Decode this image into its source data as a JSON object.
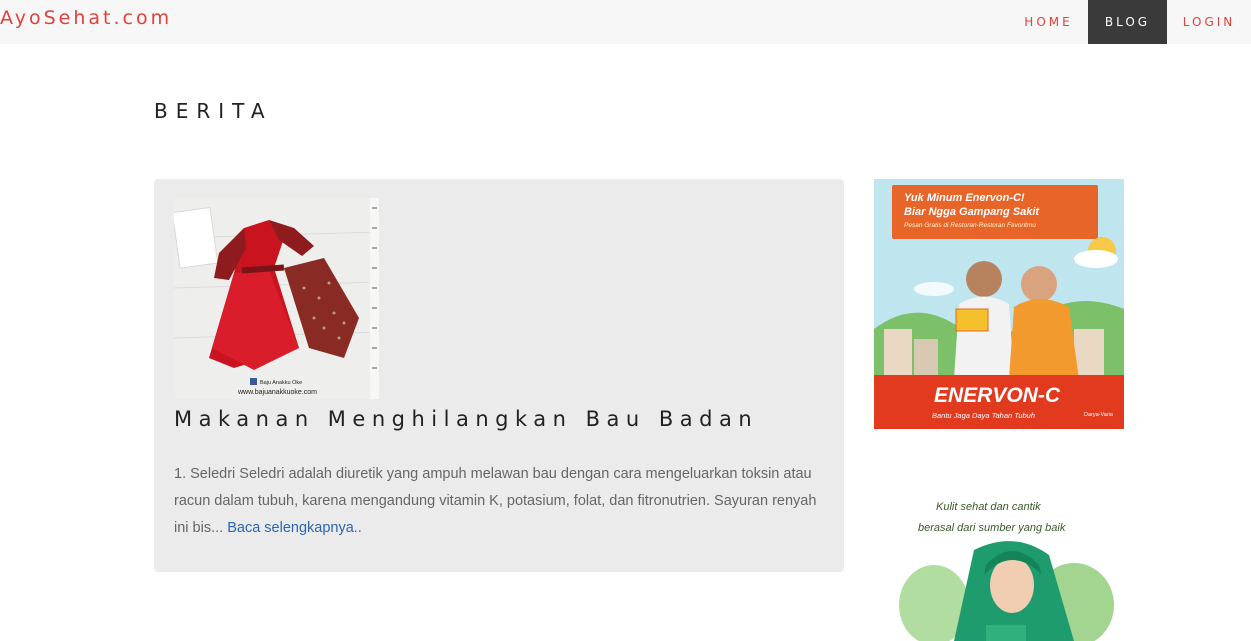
{
  "brand": {
    "name": "AyoSehat.com"
  },
  "nav": {
    "home": "HOME",
    "blog": "BLOG",
    "login": "LOGIN"
  },
  "page": {
    "title": "BERITA"
  },
  "post": {
    "title": "Makanan Menghilangkan Bau Badan",
    "excerpt": "1. Seledri Seledri adalah diuretik yang ampuh melawan bau dengan cara mengeluarkan toksin atau racun dalam tubuh, karena mengandung vitamin K, potasium, folat, dan fitronutrien. Sayuran renyah ini bis...",
    "read_more": "Baca selengkapnya..",
    "thumb_caption_1": "Baju Anakku Oke",
    "thumb_caption_2": "www.bajuanakkuoke.com"
  },
  "ads": {
    "ad1": {
      "line1": "Yuk Minum Enervon-C!",
      "line2": "Biar Ngga Gampang Sakit",
      "line3": "Pesan Gratis di Restoran-Restoran Favoritmu",
      "brand": "ENERVON-C",
      "tagline": "Bantu Jaga Daya Tahan Tubuh",
      "maker": "Darya-Varia"
    },
    "ad2": {
      "line1": "Kulit sehat dan cantik",
      "line2": "berasal dari sumber yang baik"
    }
  },
  "colors": {
    "brand": "#e0413b",
    "nav_active_bg": "#3a3a3a",
    "link": "#2a66b3",
    "card_bg": "#ebebeb",
    "ad_orange": "#e8652a"
  }
}
